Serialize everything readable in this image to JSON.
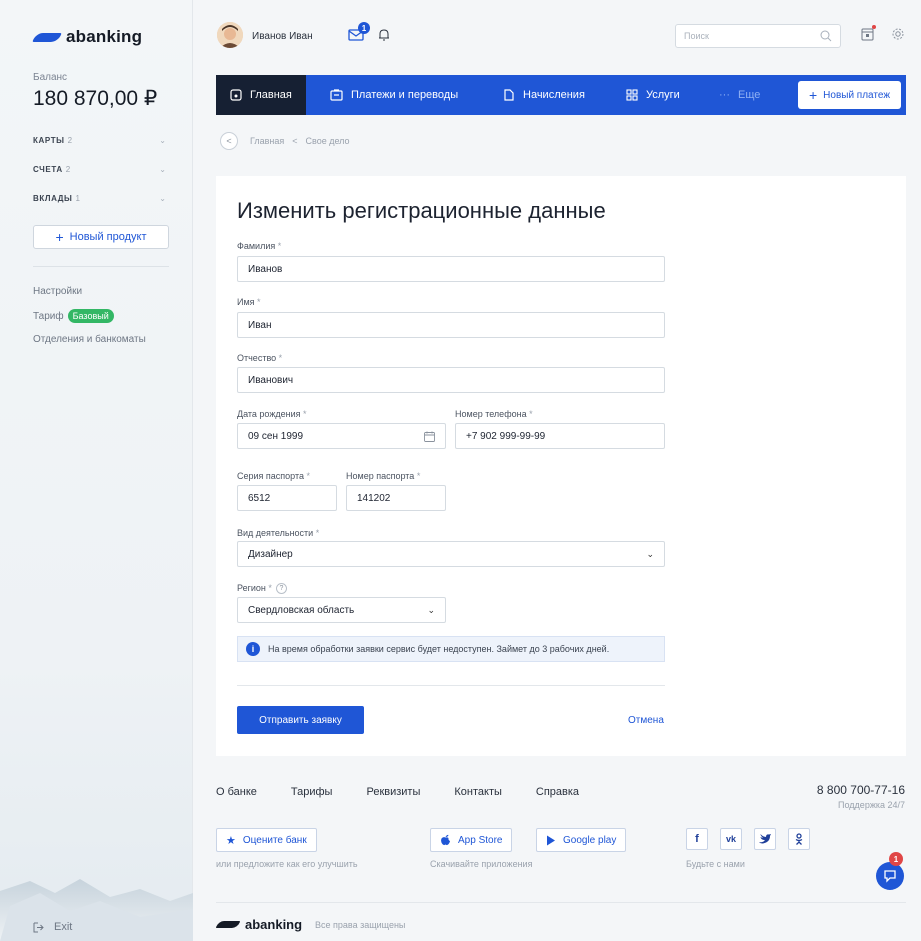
{
  "brand": {
    "name": "abanking",
    "accent": "#1f56d6",
    "dark": "#162033",
    "green": "#33b765"
  },
  "sidebar": {
    "balance_label": "Баланс",
    "balance_value": "180 870,00 ₽",
    "accounts": [
      {
        "label": "КАРТЫ",
        "count": "2"
      },
      {
        "label": "СЧЕТА",
        "count": "2"
      },
      {
        "label": "ВКЛАДЫ",
        "count": "1"
      }
    ],
    "new_product": "Новый продукт",
    "settings": "Настройки",
    "tariff_label": "Тариф",
    "tariff_badge": "Базовый",
    "branches": "Отделения и банкоматы",
    "exit": "Exit"
  },
  "header": {
    "user_name": "Иванов Иван",
    "mail_badge": "1",
    "search_placeholder": "Поиск"
  },
  "nav": {
    "items": [
      "Главная",
      "Платежи и переводы",
      "Начисления",
      "Услуги",
      "Еще"
    ],
    "new_payment": "Новый платеж"
  },
  "breadcrumb": {
    "home": "Главная",
    "separator": "<",
    "current": "Свое дело"
  },
  "form": {
    "title": "Изменить регистрационные данные",
    "required_mark": "*",
    "surname": {
      "label": "Фамилия",
      "value": "Иванов"
    },
    "name": {
      "label": "Имя",
      "value": "Иван"
    },
    "patronymic": {
      "label": "Отчество",
      "value": "Иванович"
    },
    "birthdate": {
      "label": "Дата рождения",
      "value": "09 сен 1999"
    },
    "phone": {
      "label": "Номер телефона",
      "value": "+7 902 999-99-99"
    },
    "passport_series": {
      "label": "Серия паспорта",
      "value": "6512"
    },
    "passport_number": {
      "label": "Номер паспорта",
      "value": "141202"
    },
    "activity": {
      "label": "Вид деятельности",
      "value": "Дизайнер"
    },
    "region": {
      "label": "Регион",
      "value": "Свердловская область"
    },
    "info": "На время обработки заявки сервис будет недоступен. Займет до 3 рабочих дней.",
    "submit": "Отправить заявку",
    "cancel": "Отмена"
  },
  "footer": {
    "links": [
      "О банке",
      "Тарифы",
      "Реквизиты",
      "Контакты",
      "Справка"
    ],
    "phone": "8 800 700-77-16",
    "support": "Поддержка 24/7",
    "rate_button": "Оцените банк",
    "rate_sub": "или предложите как его улучшить",
    "app_store": "App Store",
    "google_play": "Google play",
    "apps_sub": "Скачивайте приложения",
    "social": [
      "f",
      "vk",
      "tw",
      "ok"
    ],
    "social_sub": "Будьте с нами",
    "rights": "Все права защищены",
    "chat_badge": "1"
  }
}
